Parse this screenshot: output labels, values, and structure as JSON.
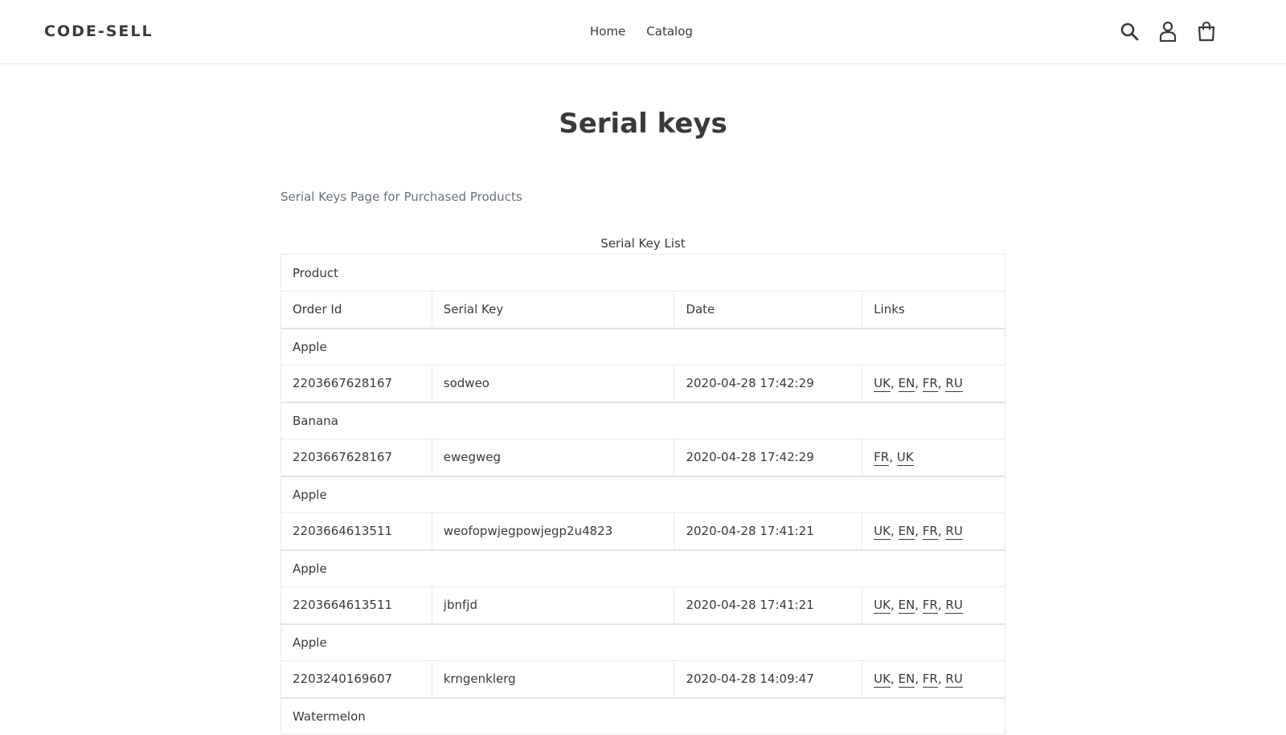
{
  "header": {
    "logo": "CODE-SELL",
    "nav": [
      {
        "label": "Home"
      },
      {
        "label": "Catalog"
      }
    ],
    "icons": [
      "search-icon",
      "account-icon",
      "cart-icon"
    ]
  },
  "page": {
    "title": "Serial keys",
    "subtitle": "Serial Keys Page for Purchased Products",
    "caption": "Serial Key List"
  },
  "table": {
    "header_product": "Product",
    "headers": [
      "Order Id",
      "Serial Key",
      "Date",
      "Links"
    ],
    "rows": [
      {
        "product": "Apple",
        "order_id": "2203667628167",
        "serial": "sodweo",
        "date": "2020-04-28 17:42:29",
        "links": [
          "UK",
          "EN",
          "FR",
          "RU"
        ]
      },
      {
        "product": "Banana",
        "order_id": "2203667628167",
        "serial": "ewegweg",
        "date": "2020-04-28 17:42:29",
        "links": [
          "FR",
          "UK"
        ]
      },
      {
        "product": "Apple",
        "order_id": "2203664613511",
        "serial": "weofopwjegpowjegp2u4823",
        "date": "2020-04-28 17:41:21",
        "links": [
          "UK",
          "EN",
          "FR",
          "RU"
        ]
      },
      {
        "product": "Apple",
        "order_id": "2203664613511",
        "serial": "jbnfjd",
        "date": "2020-04-28 17:41:21",
        "links": [
          "UK",
          "EN",
          "FR",
          "RU"
        ]
      },
      {
        "product": "Apple",
        "order_id": "2203240169607",
        "serial": "krngenklerg",
        "date": "2020-04-28 14:09:47",
        "links": [
          "UK",
          "EN",
          "FR",
          "RU"
        ]
      },
      {
        "product": "Watermelon"
      }
    ]
  }
}
